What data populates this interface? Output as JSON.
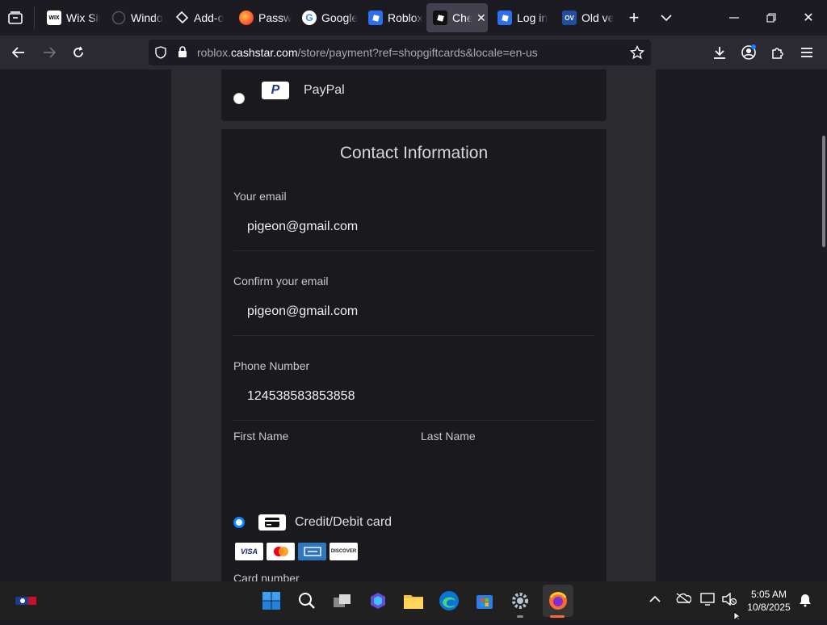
{
  "browser": {
    "tabs": [
      {
        "title": "Wix Sit",
        "icon": "wix-icon",
        "active": false
      },
      {
        "title": "Windo",
        "icon": "github-icon",
        "active": false
      },
      {
        "title": "Add-o",
        "icon": "puzzle-icon",
        "active": false
      },
      {
        "title": "Passw",
        "icon": "firefox-icon",
        "active": false
      },
      {
        "title": "Google",
        "icon": "google-icon",
        "active": false
      },
      {
        "title": "Roblox",
        "icon": "roblox-icon",
        "active": false
      },
      {
        "title": "Che",
        "icon": "roblox-icon",
        "active": true
      },
      {
        "title": "Log in",
        "icon": "roblox-icon",
        "active": false
      },
      {
        "title": "Old ve",
        "icon": "ov-icon",
        "active": false
      }
    ],
    "url_domain": "roblox.",
    "url_host": "cashstar.com",
    "url_path": "/store/payment?ref=shopgiftcards&locale=en-us"
  },
  "page": {
    "paypal_label": "PayPal",
    "contact_heading": "Contact Information",
    "email_label": "Your email",
    "email_value": "pigeon@gmail.com",
    "confirm_email_label": "Confirm your email",
    "confirm_email_value": "pigeon@gmail.com",
    "phone_label": "Phone Number",
    "phone_value": "124538583853858",
    "first_name_label": "First Name",
    "last_name_label": "Last Name",
    "card_option_label": "Credit/Debit card",
    "card_logos": [
      "VISA",
      "",
      "",
      "DISCOVER"
    ],
    "card_number_label": "Card number"
  },
  "taskbar": {
    "time": "5:05 AM",
    "date": "10/8/2025"
  },
  "colors": {
    "accent": "#0a84ff",
    "paypal_blue": "#253b80",
    "roblox_blue": "#1f6feb"
  }
}
